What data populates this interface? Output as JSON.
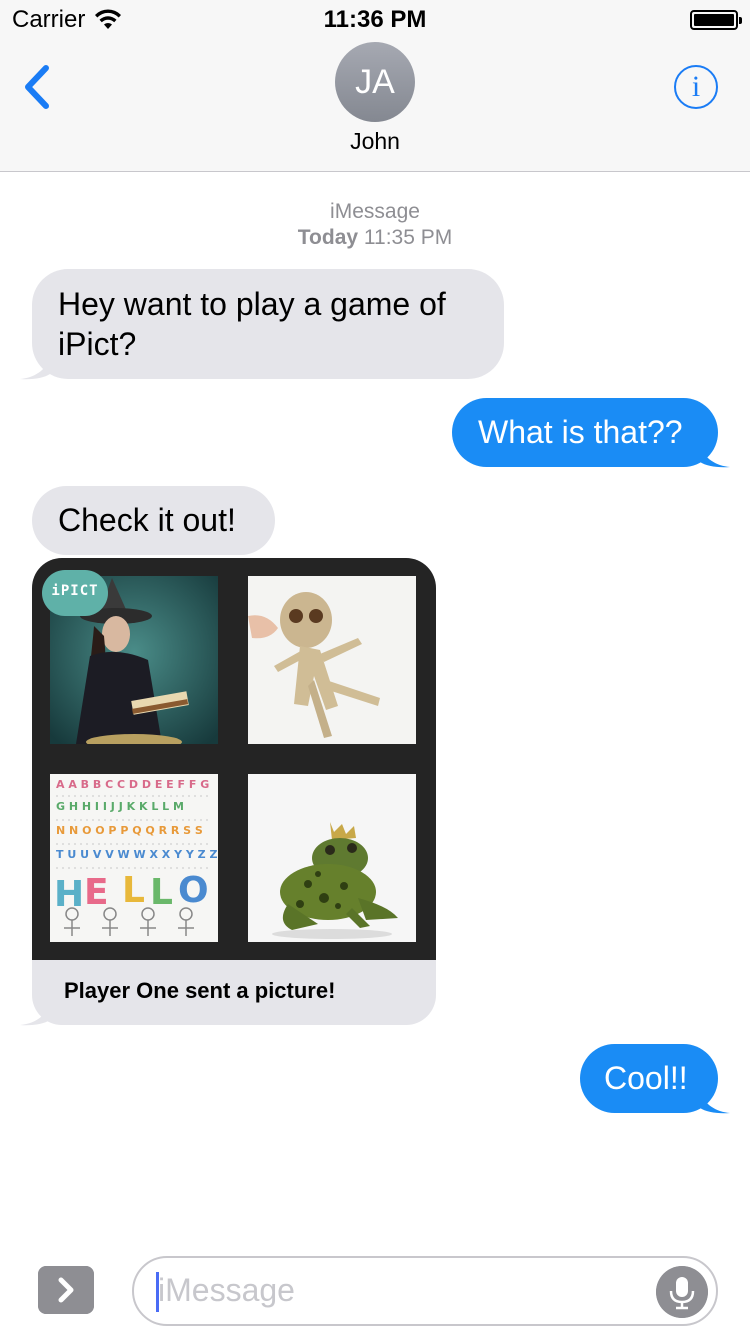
{
  "status_bar": {
    "carrier": "Carrier",
    "time": "11:36 PM",
    "battery_level": 1.0
  },
  "nav": {
    "back_icon": "chevron-left-icon",
    "avatar_initials": "JA",
    "contact_name": "John",
    "info_icon_glyph": "i"
  },
  "thread": {
    "service": "iMessage",
    "day": "Today",
    "time": "11:35 PM"
  },
  "messages": [
    {
      "direction": "incoming",
      "text": "Hey want to play a game of iPict?"
    },
    {
      "direction": "outgoing",
      "text": "What is that??"
    },
    {
      "direction": "incoming",
      "text": "Check it out!"
    },
    {
      "direction": "incoming",
      "type": "app-card",
      "app_badge": "iPICT",
      "caption": "Player One sent a picture!",
      "tiles": [
        "witch-photo",
        "voodoo-doll-photo",
        "hello-letters-photo",
        "frog-prince-photo"
      ]
    },
    {
      "direction": "outgoing",
      "text": "Cool!!"
    }
  ],
  "input": {
    "placeholder": "iMessage",
    "apps_icon": "chevron-right-icon",
    "mic_icon": "microphone-icon"
  },
  "colors": {
    "accent": "#1a7cf5",
    "outgoing_bubble": "#1a8cf5",
    "incoming_bubble": "#e5e5ea",
    "secondary_text": "#8e8e93"
  }
}
